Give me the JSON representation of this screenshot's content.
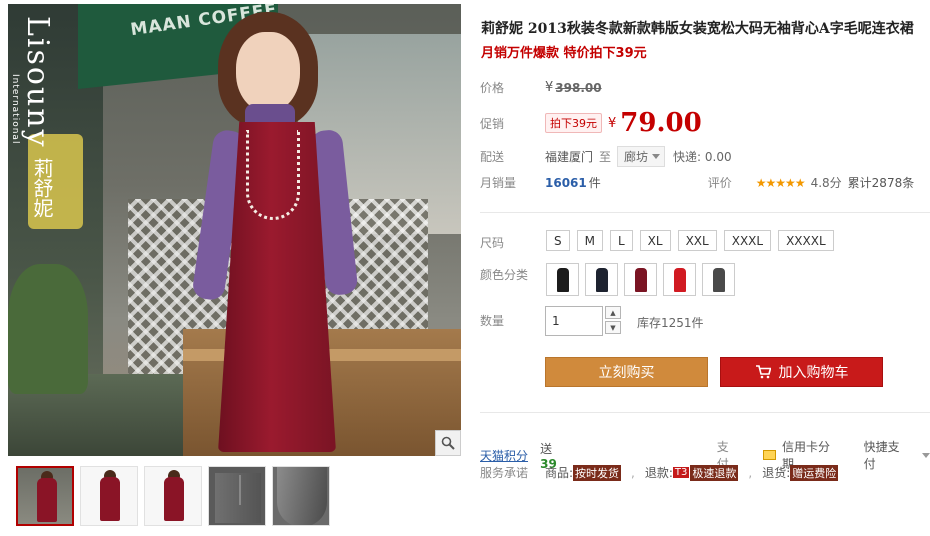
{
  "gallery": {
    "brand_latin": "Lisouny",
    "brand_sub": "International",
    "brand_cn": "莉舒妮",
    "awning_text": "MAAN COFFEE",
    "zoom_icon": "search-icon",
    "thumbnails": [
      "thumb-1",
      "thumb-2",
      "thumb-3",
      "thumb-4",
      "thumb-5"
    ]
  },
  "product": {
    "title": "莉舒妮 2013秋装冬款新款韩版女装宽松大码无袖背心A字毛呢连衣裙",
    "subtitle": "月销万件爆款 特价拍下39元"
  },
  "price": {
    "label": "价格",
    "currency": "¥",
    "original": "398.00",
    "promo_label": "促销",
    "promo_tag": "拍下39元",
    "promo_currency": "¥",
    "promo_value": "79.00"
  },
  "shipping": {
    "label": "配送",
    "from": "福建厦门",
    "to_word": "至",
    "destination": "廊坊",
    "fee": "快递: 0.00"
  },
  "sales": {
    "label": "月销量",
    "count": "16061",
    "unit": "件",
    "rating_label": "评价",
    "stars": "★★★★★",
    "score": "4.8分",
    "reviews": "累计2878条"
  },
  "options": {
    "size_label": "尺码",
    "sizes": [
      "S",
      "M",
      "L",
      "XL",
      "XXL",
      "XXXL",
      "XXXXL"
    ],
    "color_label": "颜色分类",
    "colors": [
      "#1c1c1c",
      "#1e2330",
      "#7a1423",
      "#d11a22",
      "#4a4a4a"
    ],
    "qty_label": "数量",
    "qty_value": "1",
    "stock": "库存1251件"
  },
  "actions": {
    "buy": "立刻购买",
    "cart": "加入购物车"
  },
  "extras": {
    "points_label": "天猫积分",
    "points_prefix": "送",
    "points_value": "39",
    "pay_label": "支付",
    "pay_option_1": "信用卡分期",
    "pay_option_2": "快捷支付",
    "service_label": "服务承诺",
    "svc_goods_key": "商品:",
    "svc_goods_val": "按时发货",
    "svc_refund_key": "退款:",
    "svc_refund_badge": "T3",
    "svc_refund_val": "极速退款",
    "svc_return_key": "退货:",
    "svc_return_val": "赠运费险"
  }
}
